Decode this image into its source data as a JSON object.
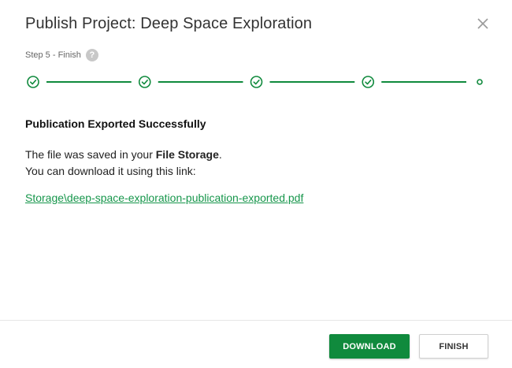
{
  "dialog": {
    "title": "Publish Project: Deep Space Exploration",
    "close_icon": "close-icon"
  },
  "step": {
    "label": "Step 5 - Finish",
    "help_icon_text": "?",
    "total": 5,
    "current": 5,
    "completed": 4
  },
  "content": {
    "heading": "Publication Exported Successfully",
    "line1_prefix": "The file was saved in your ",
    "line1_bold": "File Storage",
    "line1_suffix": ".",
    "line2": "You can download it using this link:",
    "link_text": "Storage\\deep-space-exploration-publication-exported.pdf"
  },
  "buttons": {
    "download": "DOWNLOAD",
    "finish": "FINISH"
  },
  "colors": {
    "accent": "#108a3d",
    "link": "#16964b",
    "divider": "#e6e6e6"
  }
}
